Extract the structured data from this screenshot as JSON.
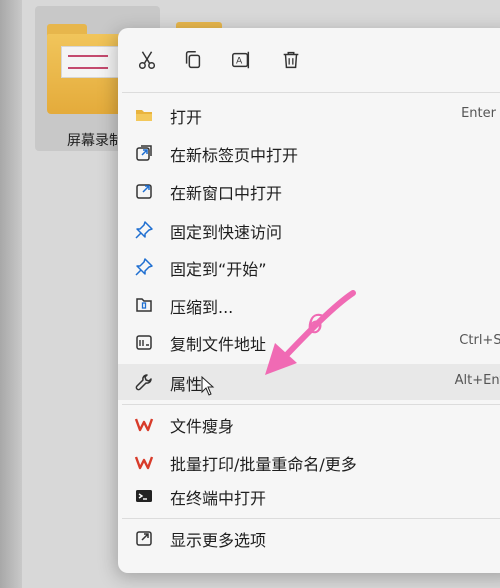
{
  "folder": {
    "label": "屏幕录制",
    "icon": "folder-icon"
  },
  "quick_actions": [
    {
      "name": "cut-icon",
      "title": "剪切"
    },
    {
      "name": "copy-icon",
      "title": "复制"
    },
    {
      "name": "rename-icon",
      "title": "重命名"
    },
    {
      "name": "delete-icon",
      "title": "删除"
    }
  ],
  "menu": {
    "items": [
      {
        "label": "打开",
        "shortcut": "Enter",
        "icon": "folder-open-icon"
      },
      {
        "label": "在新标签页中打开",
        "shortcut": "",
        "icon": "new-tab-icon"
      },
      {
        "label": "在新窗口中打开",
        "shortcut": "",
        "icon": "new-window-icon"
      },
      {
        "label": "固定到快速访问",
        "shortcut": "",
        "icon": "pin-icon"
      },
      {
        "label": "固定到“开始”",
        "shortcut": "",
        "icon": "pin-icon"
      },
      {
        "label": "压缩到...",
        "shortcut": "",
        "icon": "zip-icon"
      },
      {
        "label": "复制文件地址",
        "shortcut": "Ctrl+Shif",
        "icon": "copy-path-icon"
      },
      {
        "label": "属性",
        "shortcut": "Alt+Enter",
        "icon": "wrench-icon"
      },
      {
        "label": "文件瘦身",
        "shortcut": "",
        "icon": "wps-icon"
      },
      {
        "label": "批量打印/批量重命名/更多",
        "shortcut": "",
        "icon": "wps-icon"
      },
      {
        "label": "在终端中打开",
        "shortcut": "",
        "icon": "terminal-icon"
      },
      {
        "label": "显示更多选项",
        "shortcut": "",
        "icon": "more-options-icon"
      }
    ]
  },
  "annotation": {
    "number": "6",
    "color": "#f06ab4"
  },
  "colors": {
    "menu_bg": "#f6f6f6",
    "folder": "#e7b64c",
    "accent_blue": "#1f6fd1",
    "wps_red": "#d83b2a"
  }
}
